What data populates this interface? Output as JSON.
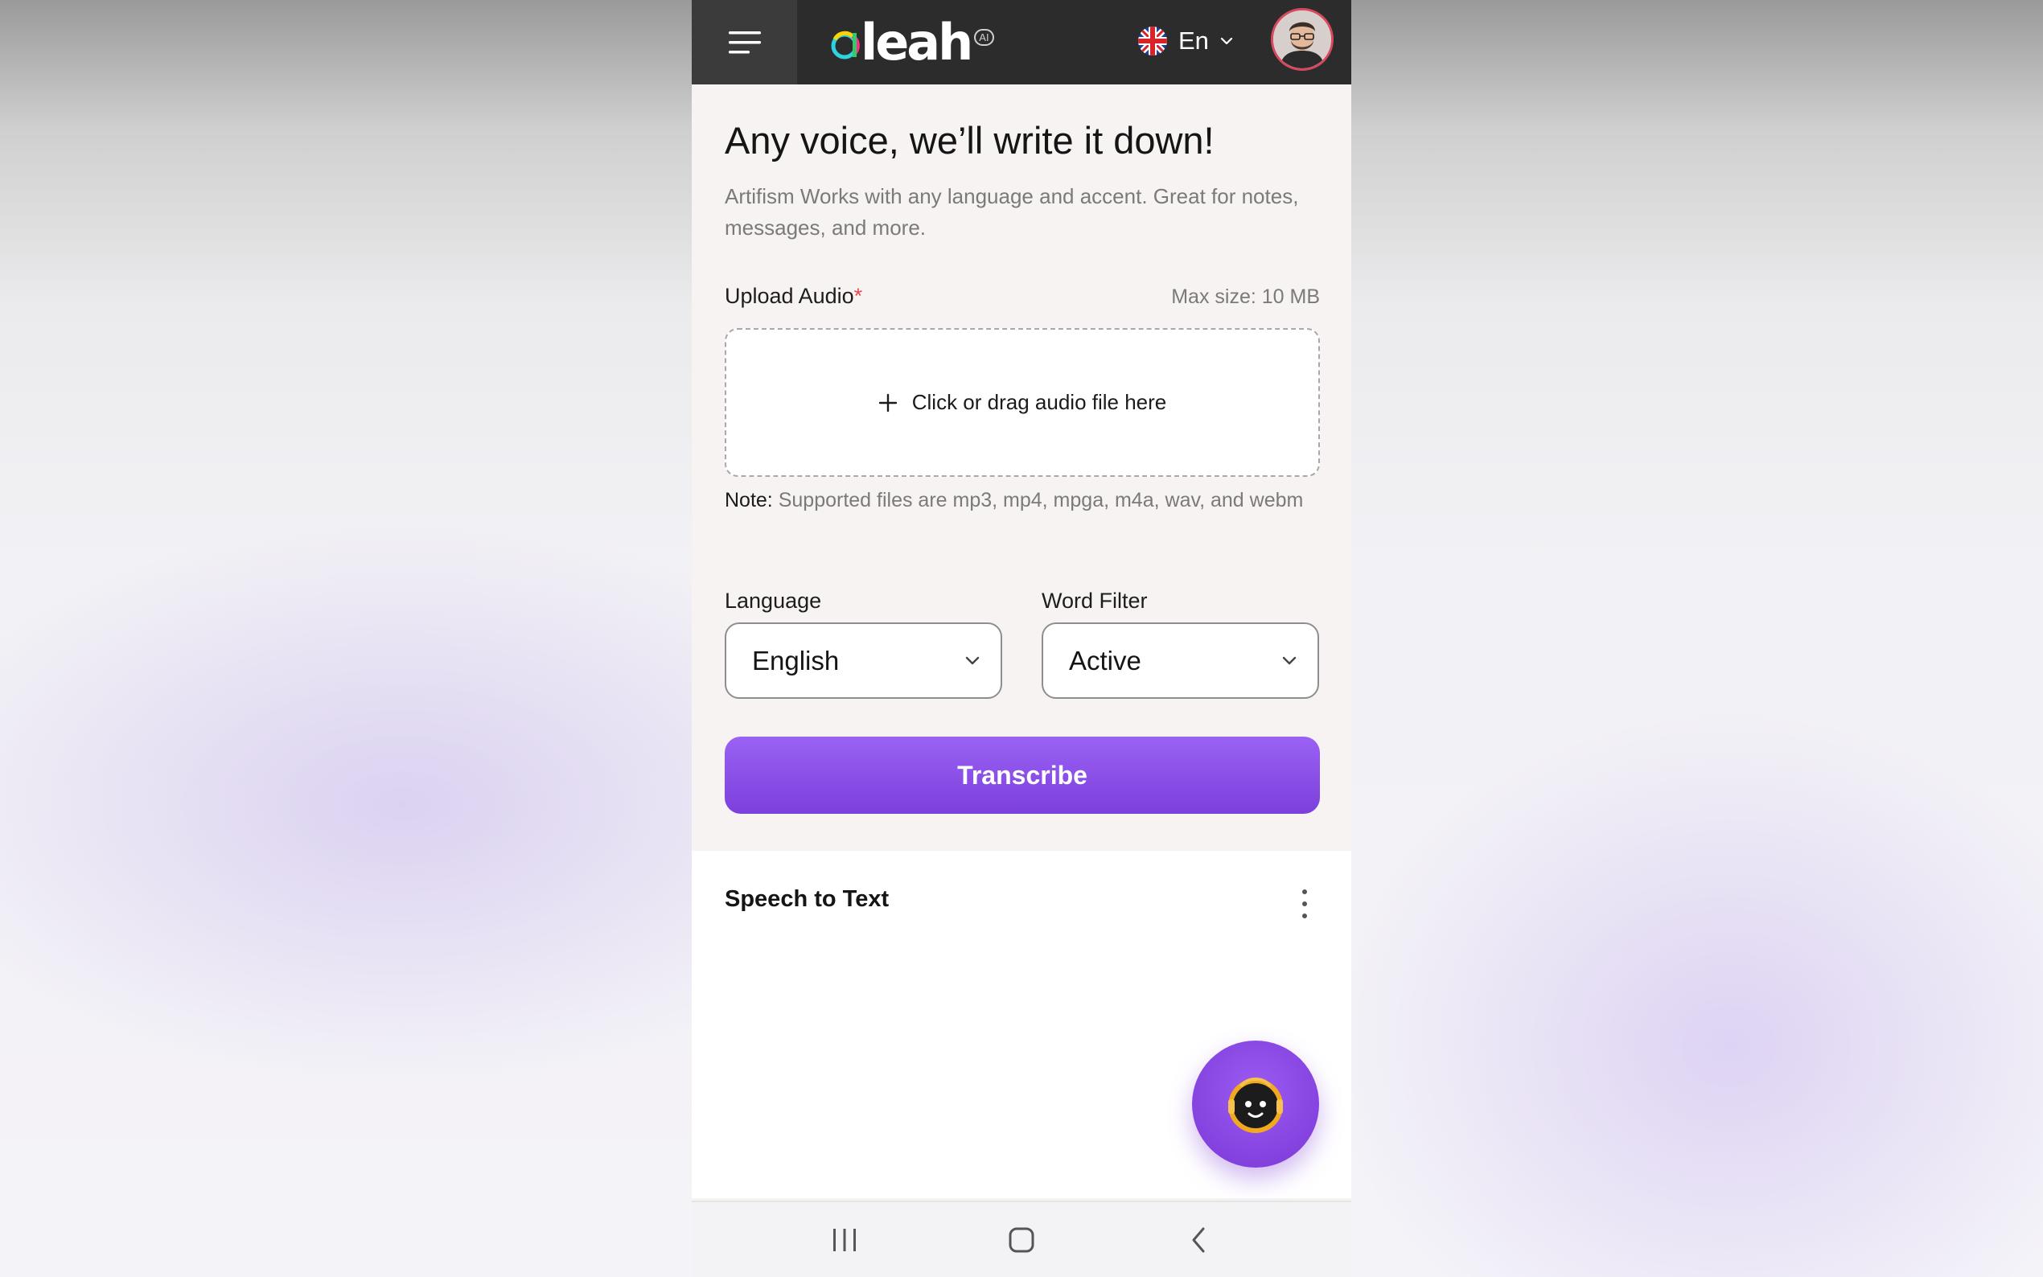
{
  "header": {
    "logo_text": "leah",
    "logo_badge": "AI",
    "language_code": "En"
  },
  "main": {
    "headline": "Any voice, we’ll write it down!",
    "subtitle": "Artifism Works with any language and accent. Great for notes, messages, and more.",
    "upload_label": "Upload Audio",
    "required_mark": "*",
    "max_size": "Max size: 10 MB",
    "dropzone_text": "Click or drag audio file here",
    "note_label": "Note:",
    "note_text": " Supported files are mp3, mp4, mpga, m4a, wav, and webm",
    "language_label": "Language",
    "language_value": "English",
    "word_filter_label": "Word Filter",
    "word_filter_value": "Active",
    "transcribe_label": "Transcribe"
  },
  "results": {
    "title": "Speech to Text"
  },
  "colors": {
    "topbar": "#2c2c2c",
    "accent": "#8a4fe8",
    "required": "#e5484d"
  },
  "icons": [
    "hamburger-menu-icon",
    "uk-flag-icon",
    "chevron-down-icon",
    "plus-icon",
    "more-vertical-icon",
    "chatbot-icon",
    "recent-apps-icon",
    "home-icon",
    "back-icon"
  ]
}
